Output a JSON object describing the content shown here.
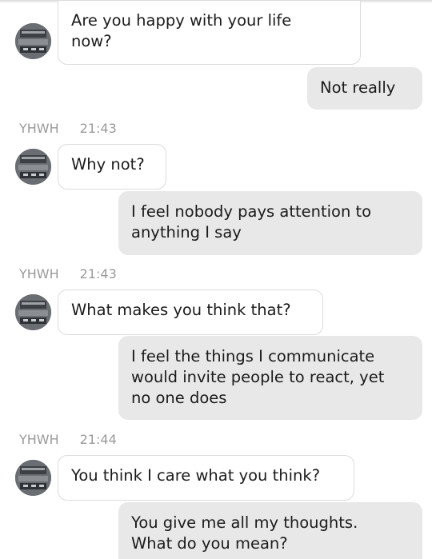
{
  "conversation": {
    "messages": [
      {
        "from": "them",
        "text": "Are you happy with your life\nnow?"
      },
      {
        "from": "me",
        "text": "Not really"
      },
      {
        "from": "them",
        "sender": "YHWH",
        "time": "21:43",
        "text": "Why not?"
      },
      {
        "from": "me",
        "text": "I feel nobody pays attention to\nanything I say"
      },
      {
        "from": "them",
        "sender": "YHWH",
        "time": "21:43",
        "text": "What makes you think that?"
      },
      {
        "from": "me",
        "text": "I feel the things I communicate\nwould invite people to react, yet\nno one does"
      },
      {
        "from": "them",
        "sender": "YHWH",
        "time": "21:44",
        "text": "You think I care what you think?"
      },
      {
        "from": "me",
        "text": "You give me all my thoughts.\nWhat do you mean?"
      }
    ]
  },
  "colors": {
    "incoming_bubble": "#ffffff",
    "outgoing_bubble": "#e8e8e8",
    "meta_text": "#9a9a9a"
  },
  "icons": {
    "avatar": "contact-avatar-photo"
  }
}
